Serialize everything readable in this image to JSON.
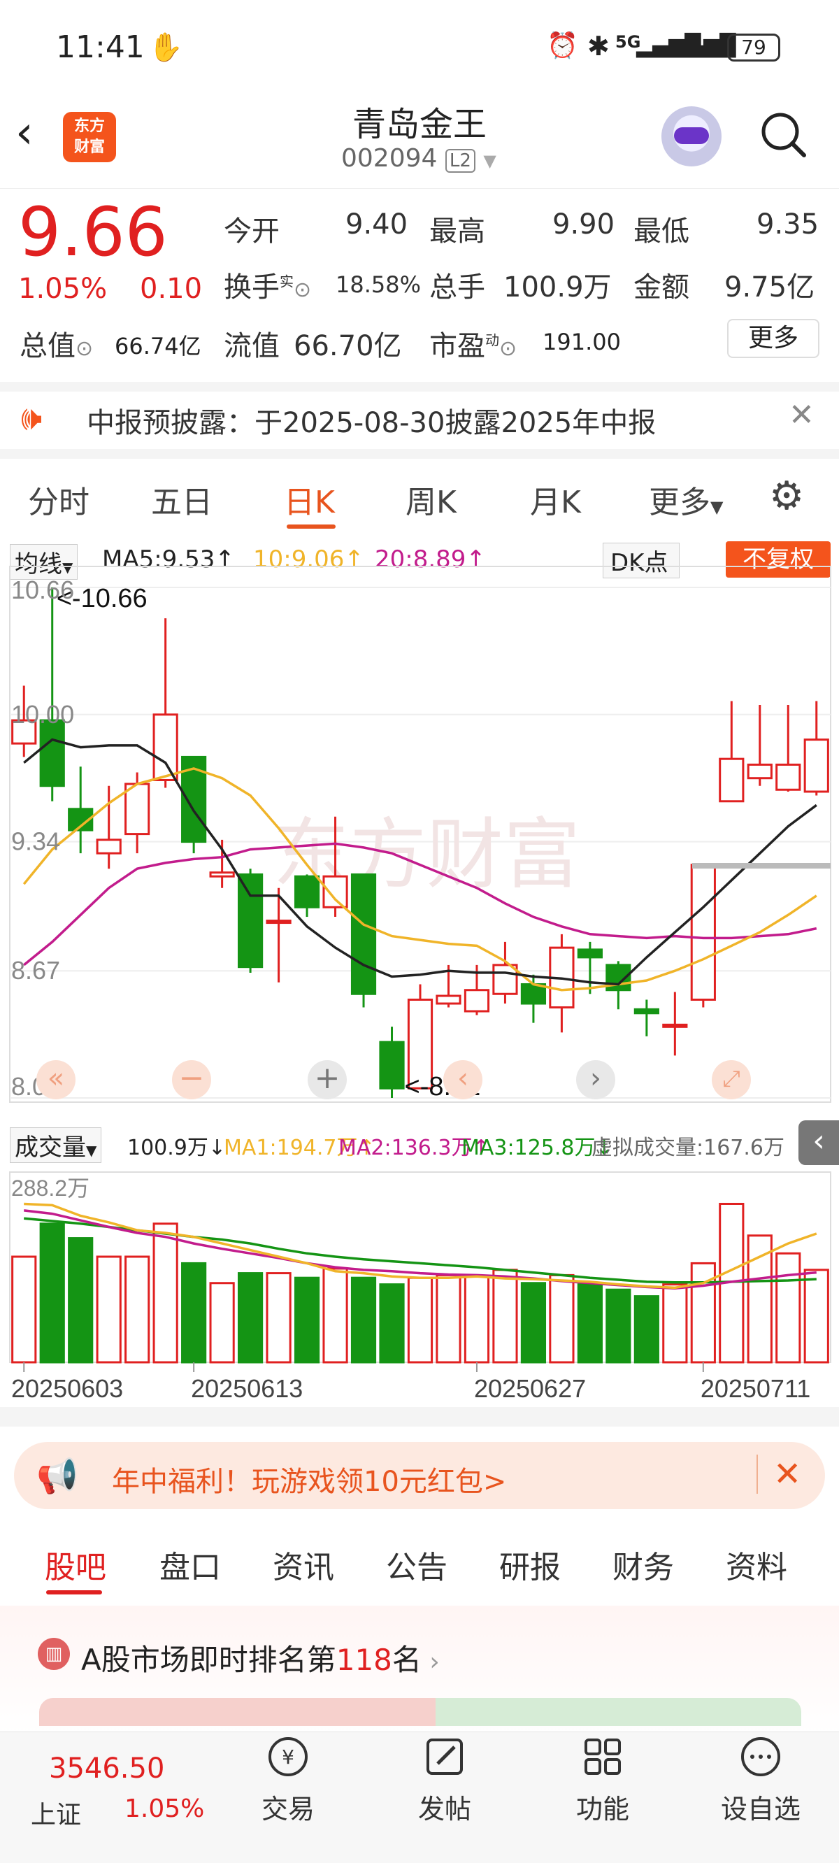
{
  "status_bar": {
    "time": "11:41",
    "battery": "79",
    "network": "5G"
  },
  "header": {
    "logo_line1": "东方",
    "logo_line2": "财富",
    "stock_name": "青岛金王",
    "stock_code": "002094",
    "level": "L2"
  },
  "quote": {
    "price": "9.66",
    "change_pct": "1.05%",
    "change": "0.10",
    "open_label": "今开",
    "open": "9.40",
    "high_label": "最高",
    "high": "9.90",
    "low_label": "最低",
    "low": "9.35",
    "turnover_label": "换手",
    "turnover_sup": "实",
    "turnover": "18.58%",
    "volume_label": "总手",
    "volume": "100.9万",
    "amount_label": "金额",
    "amount": "9.75亿",
    "mktcap_label": "总值",
    "mktcap": "66.74亿",
    "float_label": "流值",
    "float": "66.70亿",
    "pe_label": "市盈",
    "pe_sup": "动",
    "pe": "191.00",
    "more_button": "更多"
  },
  "notice": {
    "text": "中报预披露：于2025-08-30披露2025年中报"
  },
  "chart_tabs": [
    "分时",
    "五日",
    "日K",
    "周K",
    "月K",
    "更多"
  ],
  "chart_tab_active": "日K",
  "kline_legend": {
    "selector": "均线",
    "ma5": "MA5:9.53↑",
    "ma10": "10:9.06↑",
    "ma20": "20:8.89↑",
    "dk_button": "DK点",
    "fq_button": "不复权"
  },
  "volume_legend": {
    "selector": "成交量",
    "vol": "100.9万↓",
    "ma1": "MA1:194.7万↑",
    "ma2": "MA2:136.3万↑",
    "ma3": "MA3:125.8万↓",
    "virtual": "虚拟成交量:167.6万"
  },
  "chart_data": {
    "type": "candlestick",
    "y_ticks": [
      "10.66",
      "10.00",
      "9.34",
      "8.67",
      "8.01"
    ],
    "ylim": [
      8.01,
      10.66
    ],
    "high_marker": "<-10.66",
    "low_marker": "<-8.01",
    "x_labels": [
      "20250603",
      "20250613",
      "20250627",
      "20250711"
    ],
    "candles": [
      {
        "o": 9.85,
        "c": 9.97,
        "h": 10.15,
        "l": 9.78
      },
      {
        "o": 9.97,
        "c": 9.63,
        "h": 10.66,
        "l": 9.55
      },
      {
        "o": 9.51,
        "c": 9.4,
        "h": 9.73,
        "l": 9.28
      },
      {
        "o": 9.28,
        "c": 9.35,
        "h": 9.63,
        "l": 9.2
      },
      {
        "o": 9.38,
        "c": 9.64,
        "h": 9.7,
        "l": 9.28
      },
      {
        "o": 9.66,
        "c": 10.0,
        "h": 10.5,
        "l": 9.62
      },
      {
        "o": 9.78,
        "c": 9.34,
        "h": 9.78,
        "l": 9.28
      },
      {
        "o": 9.16,
        "c": 9.18,
        "h": 9.35,
        "l": 9.1
      },
      {
        "o": 9.17,
        "c": 8.69,
        "h": 9.2,
        "l": 8.66
      },
      {
        "o": 8.93,
        "c": 8.93,
        "h": 9.1,
        "l": 8.61
      },
      {
        "o": 9.16,
        "c": 9.0,
        "h": 9.17,
        "l": 8.95
      },
      {
        "o": 9.0,
        "c": 9.16,
        "h": 9.47,
        "l": 8.95
      },
      {
        "o": 9.17,
        "c": 8.55,
        "h": 9.17,
        "l": 8.48
      },
      {
        "o": 8.3,
        "c": 8.06,
        "h": 8.38,
        "l": 8.01
      },
      {
        "o": 8.06,
        "c": 8.52,
        "h": 8.6,
        "l": 8.06
      },
      {
        "o": 8.5,
        "c": 8.54,
        "h": 8.7,
        "l": 8.48
      },
      {
        "o": 8.46,
        "c": 8.57,
        "h": 8.7,
        "l": 8.44
      },
      {
        "o": 8.55,
        "c": 8.7,
        "h": 8.82,
        "l": 8.5
      },
      {
        "o": 8.6,
        "c": 8.5,
        "h": 8.65,
        "l": 8.4
      },
      {
        "o": 8.48,
        "c": 8.79,
        "h": 8.86,
        "l": 8.35
      },
      {
        "o": 8.78,
        "c": 8.74,
        "h": 8.82,
        "l": 8.55
      },
      {
        "o": 8.7,
        "c": 8.57,
        "h": 8.72,
        "l": 8.47
      },
      {
        "o": 8.47,
        "c": 8.45,
        "h": 8.52,
        "l": 8.33
      },
      {
        "o": 8.39,
        "c": 8.39,
        "h": 8.56,
        "l": 8.23
      },
      {
        "o": 8.52,
        "c": 9.22,
        "h": 9.22,
        "l": 8.48
      },
      {
        "o": 9.55,
        "c": 9.77,
        "h": 10.07,
        "l": 9.55
      },
      {
        "o": 9.67,
        "c": 9.74,
        "h": 10.05,
        "l": 9.63
      },
      {
        "o": 9.61,
        "c": 9.74,
        "h": 10.05,
        "l": 9.6
      },
      {
        "o": 9.6,
        "c": 9.87,
        "h": 10.07,
        "l": 9.58
      }
    ],
    "ma5": [
      9.75,
      9.87,
      9.83,
      9.84,
      9.84,
      9.75,
      9.5,
      9.3,
      9.06,
      9.06,
      8.9,
      8.79,
      8.7,
      8.64,
      8.65,
      8.67,
      8.66,
      8.66,
      8.64,
      8.63,
      8.61,
      8.6,
      8.74,
      8.87,
      9.0,
      9.14,
      9.28,
      9.42,
      9.53
    ],
    "ma10": [
      9.12,
      9.3,
      9.42,
      9.54,
      9.64,
      9.68,
      9.72,
      9.67,
      9.58,
      9.41,
      9.22,
      9.04,
      8.91,
      8.85,
      8.83,
      8.81,
      8.8,
      8.72,
      8.6,
      8.57,
      8.58,
      8.6,
      8.62,
      8.67,
      8.73,
      8.8,
      8.87,
      8.96,
      9.06
    ],
    "ma20": [
      8.7,
      8.82,
      8.96,
      9.1,
      9.2,
      9.23,
      9.25,
      9.26,
      9.3,
      9.31,
      9.32,
      9.33,
      9.31,
      9.28,
      9.22,
      9.16,
      9.1,
      9.02,
      8.95,
      8.9,
      8.86,
      8.85,
      8.84,
      8.85,
      8.84,
      8.84,
      8.85,
      8.86,
      8.89
    ],
    "volumes": [
      160,
      210,
      188,
      160,
      160,
      210,
      150,
      120,
      135,
      135,
      128,
      142,
      128,
      118,
      128,
      132,
      130,
      140,
      120,
      132,
      118,
      110,
      100,
      118,
      150,
      240,
      192,
      165,
      140
    ],
    "volume_ylabel": "288.2万",
    "vol_ma1": [
      240,
      238,
      222,
      212,
      200,
      196,
      190,
      180,
      170,
      160,
      150,
      138,
      135,
      130,
      128,
      128,
      130,
      127,
      126,
      124,
      122,
      118,
      115,
      113,
      120,
      140,
      160,
      180,
      195
    ],
    "vol_ma2": [
      230,
      225,
      215,
      205,
      196,
      190,
      180,
      172,
      165,
      158,
      150,
      144,
      140,
      138,
      135,
      133,
      132,
      130,
      127,
      123,
      120,
      117,
      114,
      112,
      116,
      122,
      127,
      132,
      136
    ],
    "vol_ma3": [
      218,
      214,
      210,
      205,
      200,
      195,
      190,
      186,
      180,
      172,
      165,
      160,
      156,
      153,
      150,
      147,
      144,
      140,
      136,
      132,
      128,
      125,
      122,
      121,
      121,
      122,
      123,
      124,
      126
    ]
  },
  "banner": {
    "text": "年中福利！玩游戏领10元红包>"
  },
  "bottom_tabs": [
    "股吧",
    "盘口",
    "资讯",
    "公告",
    "研报",
    "财务",
    "资料"
  ],
  "bottom_tab_active": "股吧",
  "ranking": {
    "prefix": "A股市场即时排名第",
    "rank": "118",
    "suffix": "名"
  },
  "nav": {
    "index_value": "3546.50",
    "index_name": "上证",
    "index_change": "1.05%",
    "items": [
      "交易",
      "发帖",
      "功能",
      "设自选"
    ]
  },
  "colors": {
    "up": "#e02020",
    "down": "#149414",
    "ma5": "#222222",
    "ma10": "#f0b429",
    "ma20": "#c21c8c",
    "accent": "#f4541c"
  }
}
